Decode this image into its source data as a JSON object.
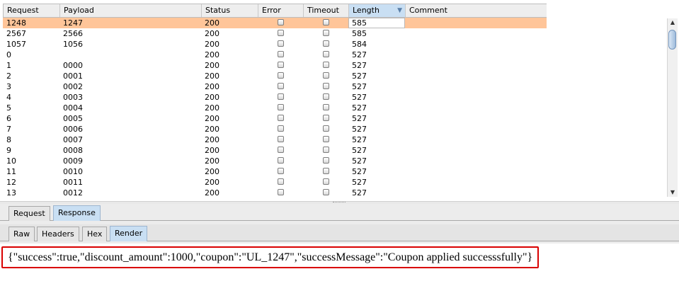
{
  "table": {
    "columns": [
      "Request",
      "Payload",
      "Status",
      "Error",
      "Timeout",
      "Length",
      "Comment"
    ],
    "sorted_column": "Length",
    "sort_arrow": "▼",
    "rows": [
      {
        "request": "1248",
        "payload": "1247",
        "status": "200",
        "length": "585",
        "selected": true
      },
      {
        "request": "2567",
        "payload": "2566",
        "status": "200",
        "length": "585"
      },
      {
        "request": "1057",
        "payload": "1056",
        "status": "200",
        "length": "584"
      },
      {
        "request": "0",
        "payload": "",
        "status": "200",
        "length": "527"
      },
      {
        "request": "1",
        "payload": "0000",
        "status": "200",
        "length": "527"
      },
      {
        "request": "2",
        "payload": "0001",
        "status": "200",
        "length": "527"
      },
      {
        "request": "3",
        "payload": "0002",
        "status": "200",
        "length": "527"
      },
      {
        "request": "4",
        "payload": "0003",
        "status": "200",
        "length": "527"
      },
      {
        "request": "5",
        "payload": "0004",
        "status": "200",
        "length": "527"
      },
      {
        "request": "6",
        "payload": "0005",
        "status": "200",
        "length": "527"
      },
      {
        "request": "7",
        "payload": "0006",
        "status": "200",
        "length": "527"
      },
      {
        "request": "8",
        "payload": "0007",
        "status": "200",
        "length": "527"
      },
      {
        "request": "9",
        "payload": "0008",
        "status": "200",
        "length": "527"
      },
      {
        "request": "10",
        "payload": "0009",
        "status": "200",
        "length": "527"
      },
      {
        "request": "11",
        "payload": "0010",
        "status": "200",
        "length": "527"
      },
      {
        "request": "12",
        "payload": "0011",
        "status": "200",
        "length": "527"
      },
      {
        "request": "13",
        "payload": "0012",
        "status": "200",
        "length": "527"
      }
    ]
  },
  "scrollbar": {
    "up_icon": "▲",
    "down_icon": "▼"
  },
  "message_tabs": [
    {
      "label": "Request",
      "active": false
    },
    {
      "label": "Response",
      "active": true
    }
  ],
  "view_tabs": [
    {
      "label": "Raw",
      "active": false
    },
    {
      "label": "Headers",
      "active": false
    },
    {
      "label": "Hex",
      "active": false
    },
    {
      "label": "Render",
      "active": true
    }
  ],
  "response": {
    "render_text": "{\"success\":true,\"discount_amount\":1000,\"coupon\":\"UL_1247\",\"successMessage\":\"Coupon applied successsfully\"}"
  },
  "colors": {
    "selected_row": "#ffc599",
    "active_tab": "#c9dff3",
    "highlight_border": "#d90000"
  }
}
